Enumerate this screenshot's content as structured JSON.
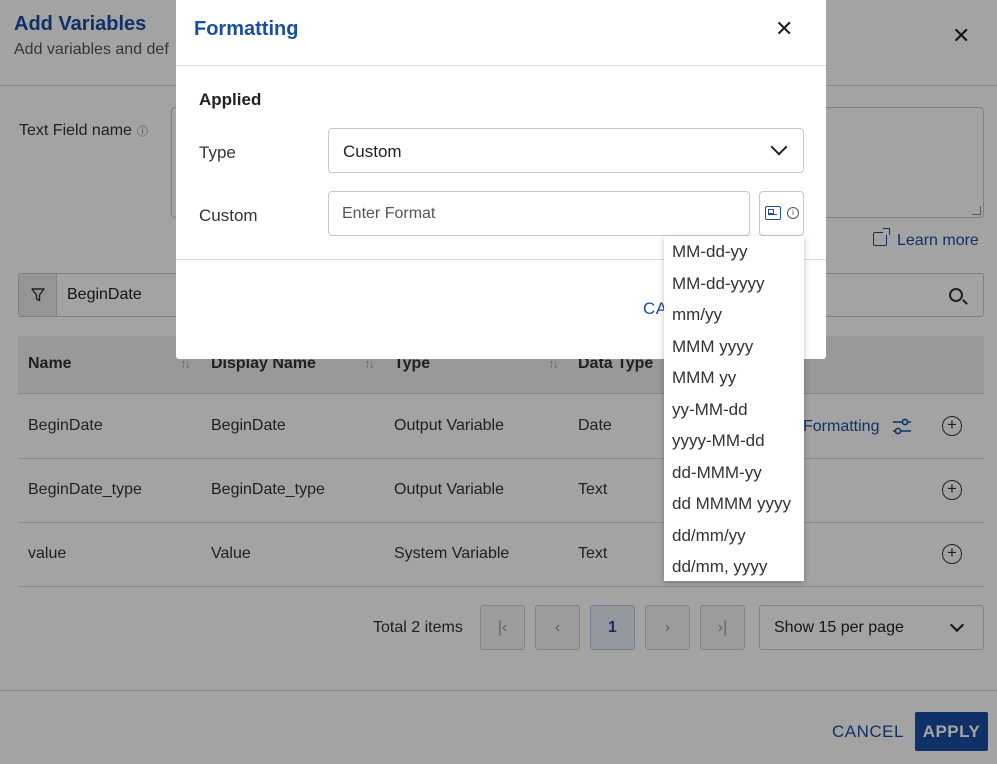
{
  "background": {
    "title": "Add Variables",
    "subtitle": "Add variables and def",
    "close_glyph": "✕",
    "text_field": {
      "label": "Text Field name",
      "info_glyph": "ⓘ",
      "value": ""
    },
    "learn_more": "Learn more",
    "search": {
      "value": "BeginDate"
    },
    "table": {
      "headers": [
        "Name",
        "Display Name",
        "Type",
        "Data Type"
      ],
      "rows": [
        {
          "name": "BeginDate",
          "display_name": "BeginDate",
          "type": "Output Variable",
          "data_type": "Date",
          "action": "Formatting"
        },
        {
          "name": "BeginDate_type",
          "display_name": "BeginDate_type",
          "type": "Output Variable",
          "data_type": "Text",
          "action": ""
        },
        {
          "name": "value",
          "display_name": "Value",
          "type": "System Variable",
          "data_type": "Text",
          "action": ""
        }
      ]
    },
    "pagination": {
      "total": "Total 2 items",
      "first": "|‹",
      "prev": "‹",
      "current_page": "1",
      "next": "›",
      "last": "›|",
      "per_page": "Show 15 per page"
    },
    "footer": {
      "cancel": "CANCEL",
      "apply": "APPLY"
    }
  },
  "modal": {
    "title": "Formatting",
    "close_glyph": "✕",
    "section": "Applied",
    "type_label": "Type",
    "type_value": "Custom",
    "custom_label": "Custom",
    "custom_placeholder": "Enter Format",
    "custom_value": "",
    "info_glyph": "i",
    "cancel_partial": "CA"
  },
  "format_options": [
    "MM-dd-yy",
    "MM-dd-yyyy",
    "mm/yy",
    "MMM yyyy",
    "MMM yy",
    "yy-MM-dd",
    "yyyy-MM-dd",
    "dd-MMM-yy",
    "dd MMMM yyyy",
    "dd/mm/yy",
    "dd/mm, yyyy"
  ],
  "colors": {
    "accent": "#1a4ea1",
    "overlay": "rgba(0,0,0,0.36)"
  }
}
